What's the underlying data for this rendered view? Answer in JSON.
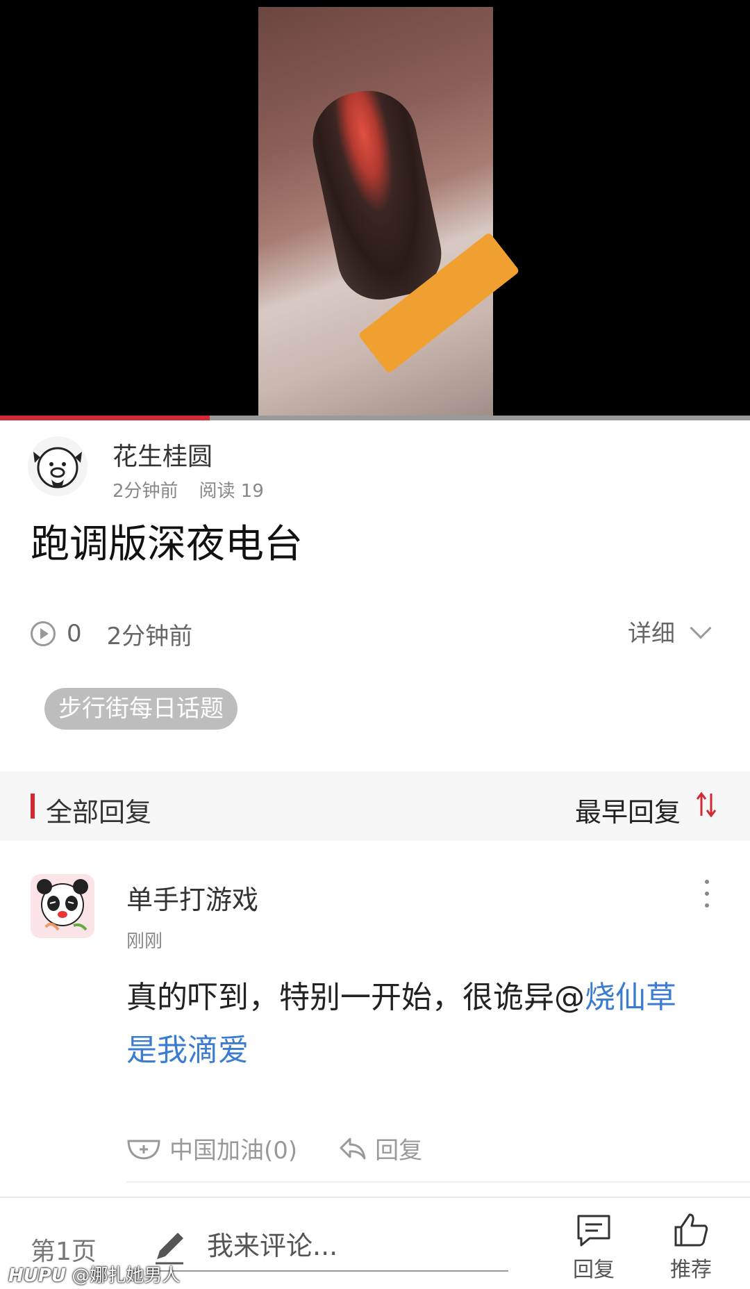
{
  "video": {
    "progress": 0.28
  },
  "author": {
    "name": "花生桂圆",
    "time": "2分钟前",
    "reads": "阅读 19"
  },
  "post": {
    "title": "跑调版深夜电台",
    "plays": "0",
    "time": "2分钟前",
    "details_label": "详细",
    "tag": "步行街每日话题"
  },
  "replies": {
    "header": "全部回复",
    "sort_label": "最早回复",
    "accent_color": "#d22a35"
  },
  "comment": {
    "username": "单手打游戏",
    "time": "刚刚",
    "text": "真的吓到，特别一开始，很诡异@",
    "mention": "烧仙草是我滴爱",
    "cheer_label": "中国加油(0)",
    "reply_label": "回复"
  },
  "bottom_bar": {
    "page_label": "第1页",
    "input_placeholder": "我来评论...",
    "reply_label": "回复",
    "recommend_label": "推荐"
  },
  "watermark": {
    "brand": "HUPU",
    "handle": "@娜扎她男人"
  }
}
